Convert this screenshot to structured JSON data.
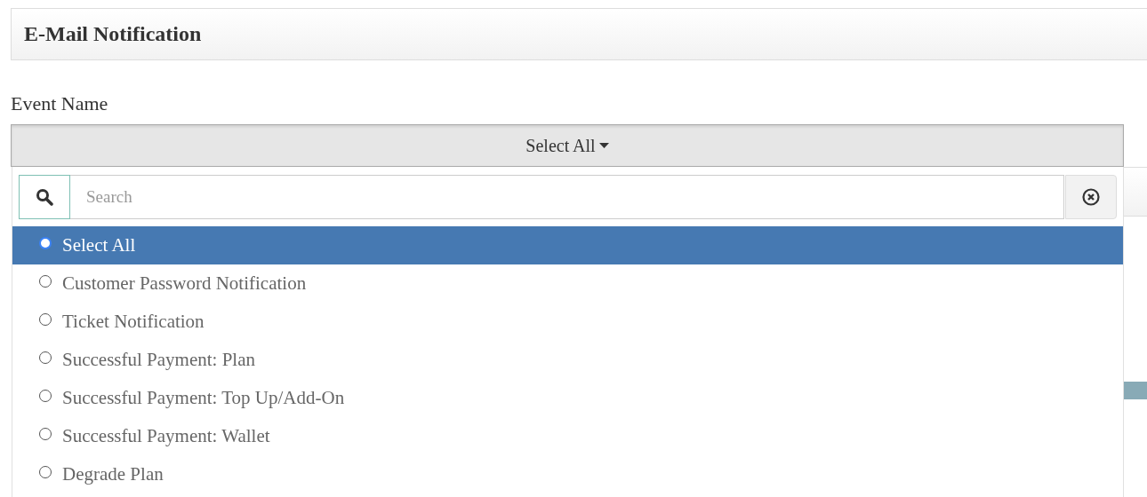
{
  "panel": {
    "title": "E-Mail Notification"
  },
  "field": {
    "label": "Event Name",
    "button_label": "Select All"
  },
  "search": {
    "placeholder": "Search"
  },
  "options": [
    {
      "label": "Select All",
      "selected": true
    },
    {
      "label": "Customer Password Notification",
      "selected": false
    },
    {
      "label": "Ticket Notification",
      "selected": false
    },
    {
      "label": "Successful Payment: Plan",
      "selected": false
    },
    {
      "label": "Successful Payment: Top Up/Add-On",
      "selected": false
    },
    {
      "label": "Successful Payment: Wallet",
      "selected": false
    },
    {
      "label": "Degrade Plan",
      "selected": false
    }
  ]
}
